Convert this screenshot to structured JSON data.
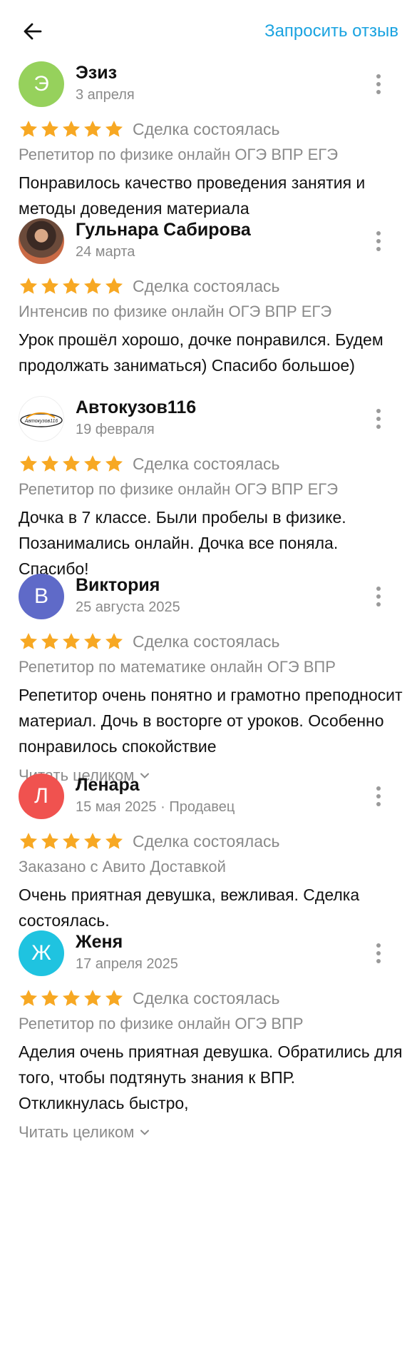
{
  "header": {
    "back_icon": "arrow-left-icon",
    "request_review": "Запросить отзыв",
    "accent_color": "#1aa3e0"
  },
  "colors": {
    "star": "#f7a823",
    "muted": "#8a8a8a"
  },
  "reviews": [
    {
      "avatar_letter": "Э",
      "avatar_color": "#96d15c",
      "name": "Эзиз",
      "date": "3 апреля",
      "rating": 5,
      "deal": "Сделка состоялась",
      "service": "Репетитор по физике онлайн ОГЭ ВПР ЕГЭ",
      "text": "Понравилось качество проведения занятия и методы доведения материала"
    },
    {
      "avatar_letter": "",
      "avatar_type": "photo",
      "name": "Гульнара Сабирова",
      "date": "24 марта",
      "rating": 5,
      "deal": "Сделка состоялась",
      "service": "Интенсив по физике онлайн ОГЭ ВПР ЕГЭ",
      "text": "Урок прошёл хорошо,  дочке понравился. Будем продолжать заниматься) Спасибо большое)"
    },
    {
      "avatar_letter": "",
      "avatar_type": "logo",
      "avatar_logo_text": "Автокузов116",
      "name": "Автокузов116",
      "date": "19 февраля",
      "rating": 5,
      "deal": "Сделка состоялась",
      "service": "Репетитор по физике онлайн ОГЭ ВПР ЕГЭ",
      "text": "Дочка в 7 классе. Были пробелы в физике. Позанимались онлайн. Дочка все поняла. Спасибо!"
    },
    {
      "avatar_letter": "В",
      "avatar_color": "#5f6ac8",
      "name": "Виктория",
      "date": "25 августа 2025",
      "rating": 5,
      "deal": "Сделка состоялась",
      "service": "Репетитор по математике онлайн ОГЭ ВПР",
      "text": "Репетитор очень понятно и грамотно преподносит материал. Дочь в восторге от уроков. Особенно понравилось спокойствие",
      "read_more": "Читать целиком"
    },
    {
      "avatar_letter": "Л",
      "avatar_color": "#f0524f",
      "name": "Ленара",
      "date": "15 мая 2025 · Продавец",
      "rating": 5,
      "deal": "Сделка состоялась",
      "service": "Заказано с Авито Доставкой",
      "text": "Очень приятная девушка, вежливая. Сделка состоялась."
    },
    {
      "avatar_letter": "Ж",
      "avatar_color": "#1fc3e0",
      "name": "Женя",
      "date": "17 апреля 2025",
      "rating": 5,
      "deal": "Сделка состоялась",
      "service": "Репетитор по физике онлайн ОГЭ ВПР",
      "text": "Аделия очень приятная девушка. Обратились для того, чтобы подтянуть знания к ВПР. Откликнулась быстро,",
      "read_more": "Читать целиком"
    }
  ]
}
